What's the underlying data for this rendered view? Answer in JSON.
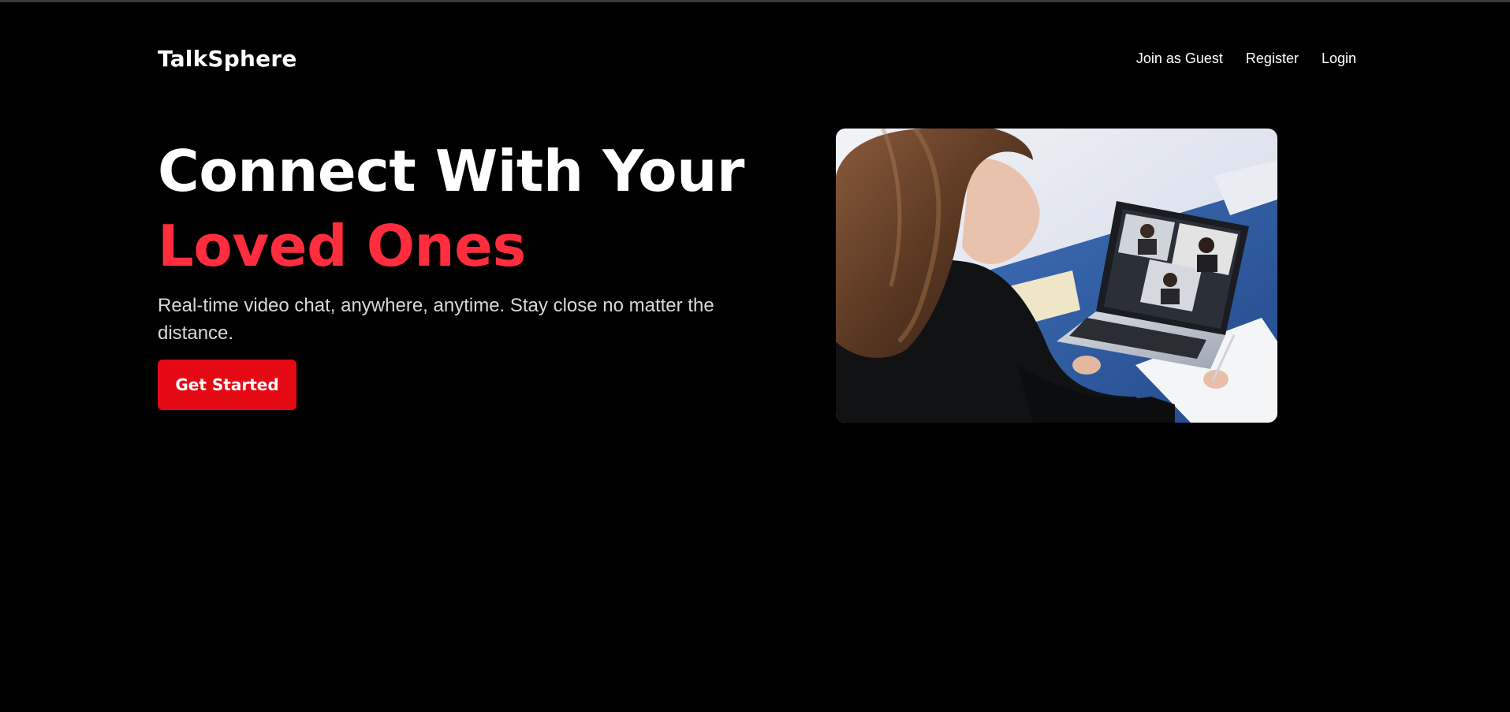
{
  "brand": {
    "name": "TalkSphere"
  },
  "nav": {
    "items": [
      {
        "label": "Join as Guest"
      },
      {
        "label": "Register"
      },
      {
        "label": "Login"
      }
    ]
  },
  "hero": {
    "headline_line1": "Connect With Your",
    "headline_line2": "Loved Ones",
    "subtitle": "Real-time video chat, anywhere, anytime. Stay close no matter the distance.",
    "cta_label": "Get Started",
    "image_subject": "woman-on-video-call-photo"
  },
  "colors": {
    "background": "#000000",
    "text": "#ffffff",
    "accent": "#ff2d3d",
    "button": "#e50914"
  }
}
